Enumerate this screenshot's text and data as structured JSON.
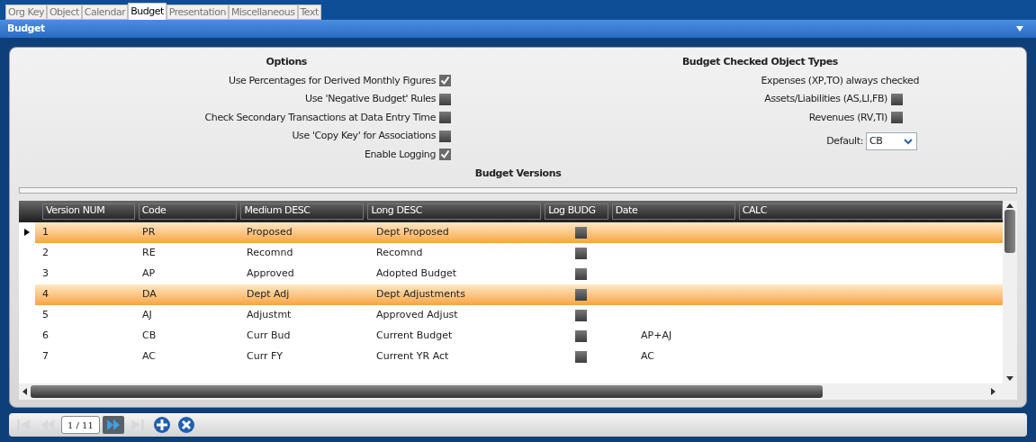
{
  "tabs": [
    {
      "label": "Org Key",
      "selected": false
    },
    {
      "label": "Object",
      "selected": false
    },
    {
      "label": "Calendar",
      "selected": false
    },
    {
      "label": "Budget",
      "selected": true
    },
    {
      "label": "Presentation",
      "selected": false
    },
    {
      "label": "Miscellaneous",
      "selected": false
    },
    {
      "label": "Text",
      "selected": false
    }
  ],
  "panel": {
    "title": "Budget"
  },
  "options": {
    "title": "Options",
    "items": [
      {
        "label": "Use Percentages for Derived Monthly Figures",
        "checked": true
      },
      {
        "label": "Use 'Negative Budget' Rules",
        "checked": false
      },
      {
        "label": "Check Secondary Transactions at Data Entry Time",
        "checked": false
      },
      {
        "label": "Use 'Copy Key' for Associations",
        "checked": false
      },
      {
        "label": "Enable Logging",
        "checked": true
      }
    ]
  },
  "object_types": {
    "title": "Budget Checked Object Types",
    "note": "Expenses (XP,TO) always checked",
    "items": [
      {
        "label": "Assets/Liabilities (AS,LI,FB)",
        "checked": false
      },
      {
        "label": "Revenues (RV,TI)",
        "checked": false
      }
    ],
    "default_label": "Default:",
    "default_value": "CB"
  },
  "versions": {
    "title": "Budget Versions",
    "columns": [
      "Version NUM",
      "Code",
      "Medium DESC",
      "Long DESC",
      "Log BUDG",
      "Date",
      "CALC"
    ],
    "rows": [
      {
        "num": "1",
        "code": "PR",
        "medium": "Proposed",
        "long": "Dept Proposed",
        "log": false,
        "date": "",
        "selected": true,
        "current": true
      },
      {
        "num": "2",
        "code": "RE",
        "medium": "Recomnd",
        "long": "Recomnd",
        "log": false,
        "date": "",
        "selected": false,
        "current": false
      },
      {
        "num": "3",
        "code": "AP",
        "medium": "Approved",
        "long": "Adopted Budget",
        "log": false,
        "date": "",
        "selected": false,
        "current": false
      },
      {
        "num": "4",
        "code": "DA",
        "medium": "Dept Adj",
        "long": "Dept Adjustments",
        "log": false,
        "date": "",
        "selected": true,
        "current": false
      },
      {
        "num": "5",
        "code": "AJ",
        "medium": "Adjustmt",
        "long": "Approved Adjust",
        "log": false,
        "date": "",
        "selected": false,
        "current": false
      },
      {
        "num": "6",
        "code": "CB",
        "medium": "Curr Bud",
        "long": "Current Budget",
        "log": false,
        "date": "AP+AJ",
        "selected": false,
        "current": false
      },
      {
        "num": "7",
        "code": "AC",
        "medium": "Curr FY",
        "long": "Current YR Act",
        "log": false,
        "date": "AC",
        "selected": false,
        "current": false
      }
    ]
  },
  "navigator": {
    "position": "1 / 11",
    "buttons": [
      {
        "kind": "first",
        "disabled": true
      },
      {
        "kind": "prev",
        "disabled": true
      },
      {
        "kind": "next",
        "disabled": false
      },
      {
        "kind": "last",
        "disabled": true
      }
    ],
    "actions": [
      {
        "kind": "add"
      },
      {
        "kind": "delete"
      }
    ]
  }
}
